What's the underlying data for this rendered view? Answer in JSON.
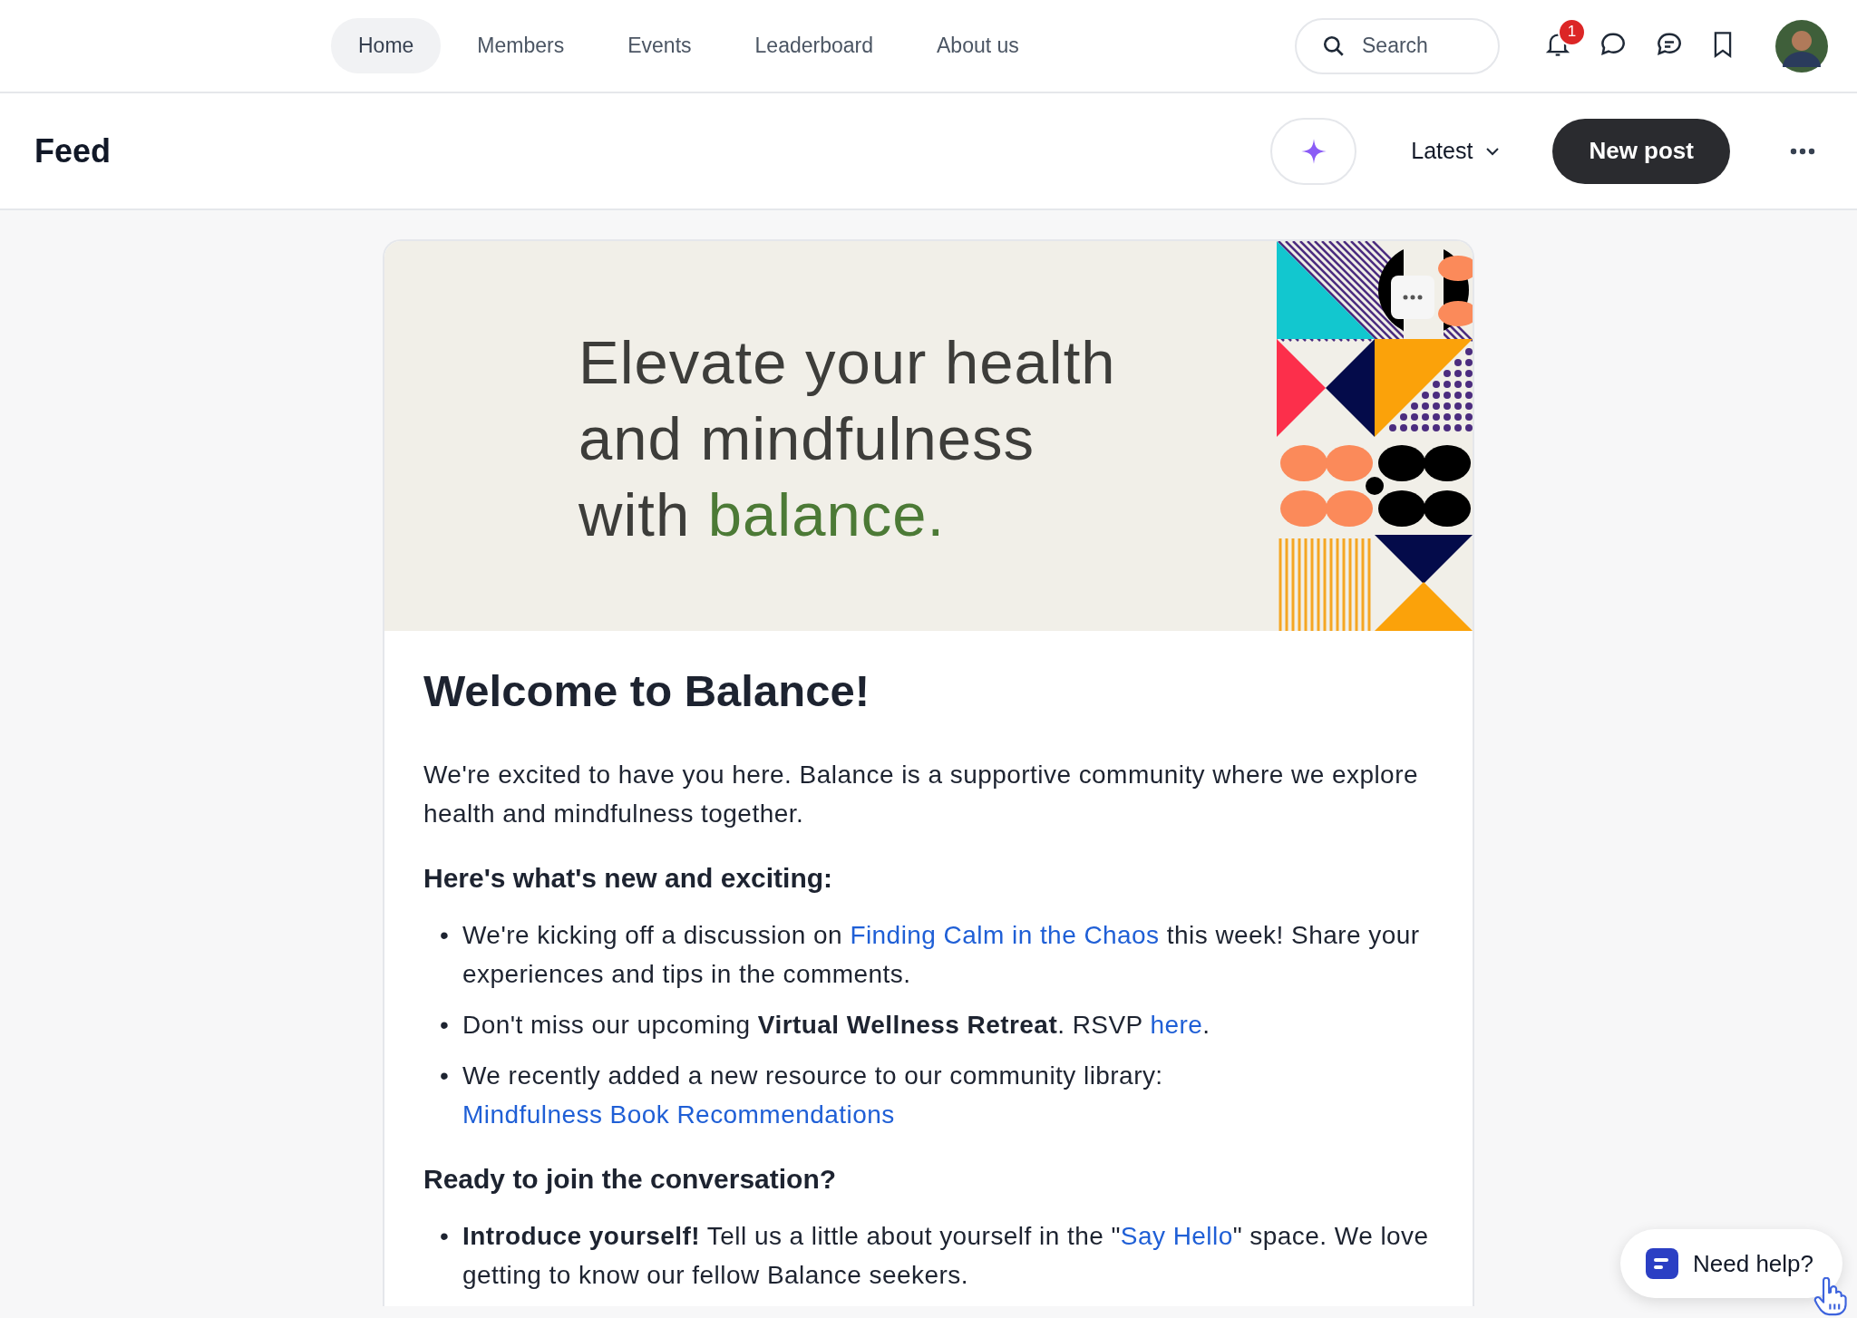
{
  "nav": {
    "items": [
      {
        "label": "Home",
        "selected": true
      },
      {
        "label": "Members",
        "selected": false
      },
      {
        "label": "Events",
        "selected": false
      },
      {
        "label": "Leaderboard",
        "selected": false
      },
      {
        "label": "About us",
        "selected": false
      }
    ],
    "search": {
      "placeholder": "Search"
    },
    "notification_count": "1"
  },
  "feed_header": {
    "title": "Feed",
    "sort": "Latest",
    "new_post": "New post"
  },
  "post": {
    "banner": {
      "heading_lines": [
        "Elevate your health",
        "and mindfulness",
        "with"
      ],
      "highlight": "balance."
    },
    "title": "Welcome to Balance!",
    "intro": "We're excited to have you here. Balance is a supportive community where we explore health and mindfulness together.",
    "sections": [
      {
        "heading": "Here's what's new and exciting:",
        "bullets": [
          {
            "marker": "•",
            "parts": [
              {
                "kind": "plain",
                "text": "We're kicking off a discussion on "
              },
              {
                "kind": "link",
                "text": "Finding Calm in the Chaos"
              },
              {
                "kind": "plain",
                "text": " this week! Share your experiences and tips in the comments."
              }
            ]
          },
          {
            "marker": "•",
            "parts": [
              {
                "kind": "plain",
                "text": "Don't miss our upcoming "
              },
              {
                "kind": "bold",
                "text": "Virtual Wellness Retreat"
              },
              {
                "kind": "plain",
                "text": ". RSVP "
              },
              {
                "kind": "link",
                "text": "here"
              },
              {
                "kind": "plain",
                "text": "."
              }
            ]
          },
          {
            "marker": "•",
            "parts": [
              {
                "kind": "plain",
                "text": "We recently added a new resource to our community library: "
              },
              {
                "kind": "link",
                "text": "Mindfulness Book Recommendations"
              }
            ]
          }
        ]
      },
      {
        "heading": "Ready to join the conversation?",
        "bullets": [
          {
            "marker": "•",
            "parts": [
              {
                "kind": "bold",
                "text": "Introduce yourself!"
              },
              {
                "kind": "plain",
                "text": " Tell us a little about yourself in the \""
              },
              {
                "kind": "link",
                "text": "Say Hello"
              },
              {
                "kind": "plain",
                "text": "\" space. We love getting to know our fellow Balance seekers."
              }
            ]
          }
        ]
      }
    ]
  },
  "help_button": "Need help?"
}
